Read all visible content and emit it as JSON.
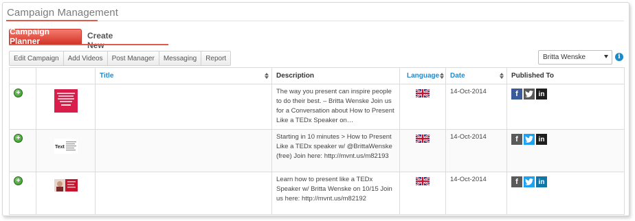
{
  "header": {
    "title": "Campaign Management"
  },
  "tabs": [
    {
      "label": "Campaign Planner",
      "active": true
    },
    {
      "label": "Create New Campaign",
      "active": false
    }
  ],
  "toolbar": {
    "buttons": [
      "Edit Campaign",
      "Add Videos",
      "Post Manager",
      "Messaging",
      "Report"
    ]
  },
  "account_select": {
    "value": "Britta Wenske"
  },
  "table": {
    "columns": [
      "",
      "",
      "Title",
      "Description",
      "Language",
      "Date",
      "Published To"
    ],
    "rows": [
      {
        "title": "",
        "description": "The way you present can inspire people to do their best. – Britta Wenske Join us for a Conversation about How to Present Like a TEDx Speaker on…",
        "language": "english-uk-flag",
        "date": "14-Oct-2014",
        "published_to": [
          "facebook-icon",
          "twitter-icon",
          "linkedin-icon"
        ]
      },
      {
        "title": "",
        "description": "Starting in 10 minutes > How to Present Like a TEDx speaker w/ @BrittaWenske (free) Join here: http://mvnt.us/m82193",
        "language": "english-uk-flag",
        "date": "14-Oct-2014",
        "published_to": [
          "facebook-icon",
          "twitter-icon",
          "linkedin-icon"
        ]
      },
      {
        "title": "",
        "description": "Learn how to present like a TEDx Speaker w/ Britta Wenske on 10/15 Join us here: http://mvnt.us/m82192",
        "language": "english-uk-flag",
        "date": "14-Oct-2014",
        "published_to": [
          "facebook-icon",
          "twitter-icon",
          "linkedin-icon"
        ]
      }
    ]
  },
  "colors": {
    "accent": "#e05a4a",
    "link": "#2a88c6",
    "add": "#3a9a28"
  },
  "thumbnail_texts": {
    "row2": "Text"
  }
}
